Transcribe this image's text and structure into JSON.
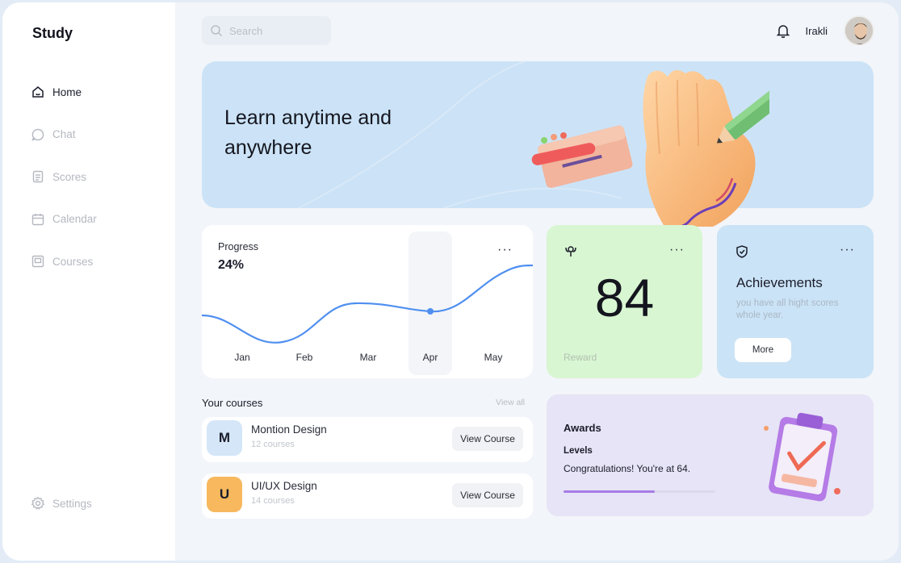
{
  "app": {
    "logo": "Study"
  },
  "sidebar": {
    "items": [
      {
        "label": "Home",
        "icon": "home-icon",
        "active": true
      },
      {
        "label": "Chat",
        "icon": "chat-icon",
        "active": false
      },
      {
        "label": "Scores",
        "icon": "scores-icon",
        "active": false
      },
      {
        "label": "Calendar",
        "icon": "calendar-icon",
        "active": false
      },
      {
        "label": "Courses",
        "icon": "courses-icon",
        "active": false
      }
    ],
    "settings_label": "Settings"
  },
  "header": {
    "search_placeholder": "Search",
    "username": "Irakli"
  },
  "hero": {
    "title": "Learn anytime and anywhere"
  },
  "progress": {
    "label": "Progress",
    "value": "24%",
    "months": [
      "Jan",
      "Feb",
      "Mar",
      "Apr",
      "May"
    ],
    "selected_month": "Apr"
  },
  "reward": {
    "value": "84",
    "label": "Reward"
  },
  "achievements": {
    "title": "Achievements",
    "description": "you have all hight scores whole year.",
    "button": "More"
  },
  "courses": {
    "title": "Your courses",
    "view_all": "View all",
    "items": [
      {
        "letter": "M",
        "name": "Montion Design",
        "count": "12 courses",
        "button": "View Course",
        "color": "#d4e6f8"
      },
      {
        "letter": "U",
        "name": "UI/UX Design",
        "count": "14 courses",
        "button": "View Course",
        "color": "#f7b85e"
      }
    ]
  },
  "awards": {
    "title": "Awards",
    "levels_label": "Levels",
    "message": "Congratulations! You're at 64.",
    "progress": 0.6
  },
  "colors": {
    "accent_blue": "#4f8ff0",
    "hero_bg": "#cce3f7",
    "reward_bg": "#d8f6d2",
    "awards_bar": "#a77ce6"
  }
}
